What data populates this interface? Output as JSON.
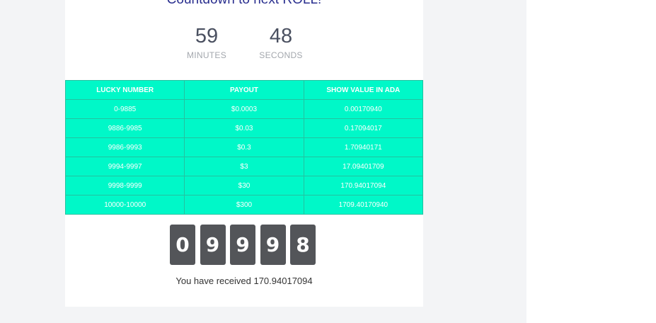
{
  "countdown": {
    "title": "Countdown to next ROLL!",
    "minutes_value": "59",
    "minutes_label": "MINUTES",
    "seconds_value": "48",
    "seconds_label": "SECONDS"
  },
  "payout_table": {
    "headers": [
      "LUCKY NUMBER",
      "PAYOUT",
      "SHOW VALUE IN ADA"
    ],
    "rows": [
      [
        "0-9885",
        "$0.0003",
        "0.00170940"
      ],
      [
        "9886-9985",
        "$0.03",
        "0.17094017"
      ],
      [
        "9986-9993",
        "$0.3",
        "1.70940171"
      ],
      [
        "9994-9997",
        "$3",
        "17.09401709"
      ],
      [
        "9998-9999",
        "$30",
        "170.94017094"
      ],
      [
        "10000-10000",
        "$300",
        "1709.40170940"
      ]
    ]
  },
  "roll_digits": [
    "0",
    "9",
    "9",
    "9",
    "8"
  ],
  "result_message": "You have received 170.94017094",
  "colors": {
    "table_bg": "#00f8c8",
    "digit_bg": "#535559",
    "title_color": "#2a2f8f"
  }
}
